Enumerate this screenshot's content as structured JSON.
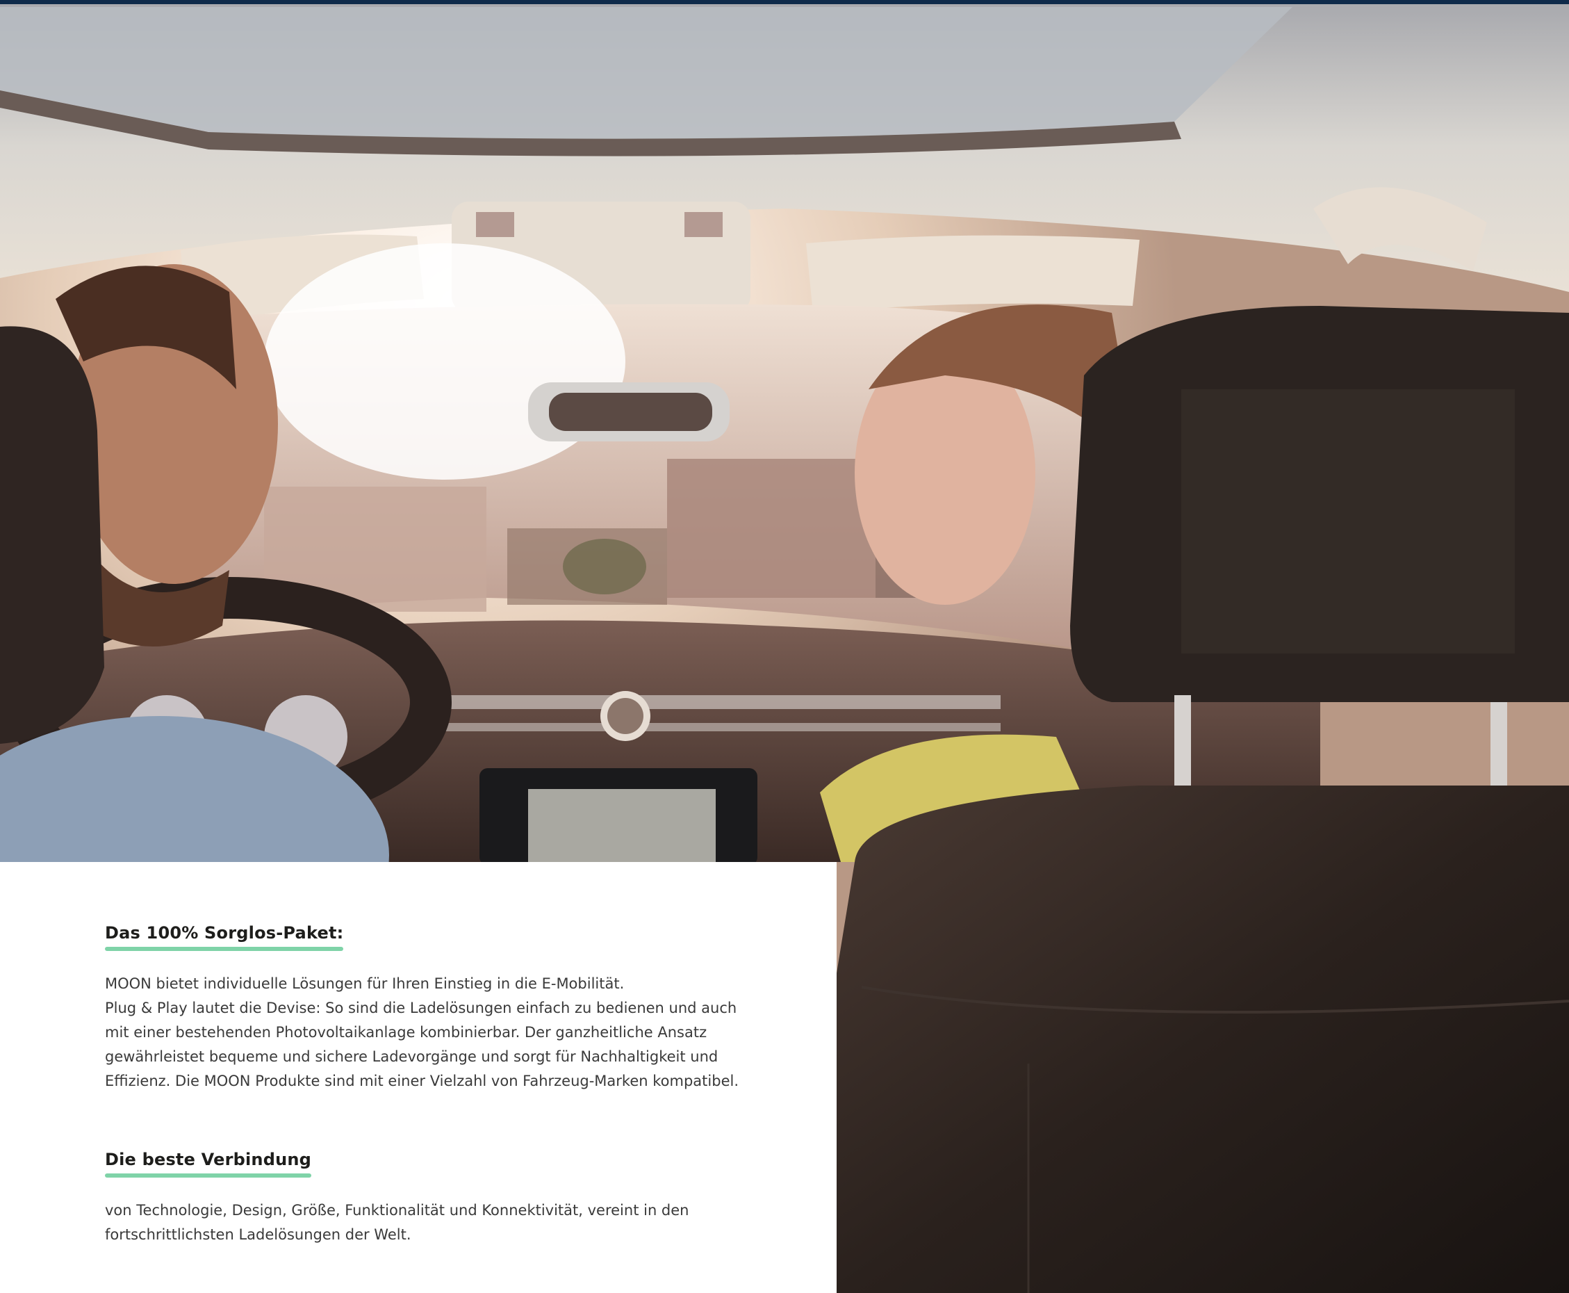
{
  "colors": {
    "top_strip": "#0e2a4a",
    "panel_background": "#ffffff",
    "accent_underline": "#7fd3a8",
    "heading_text": "#1d1d1b",
    "body_text": "#3a3a3a"
  },
  "sections": [
    {
      "heading": "Das 100% Sorglos-Paket:",
      "lines": [
        "MOON bietet individuelle Lösungen für Ihren Einstieg in die E-Mobilität.",
        "Plug & Play lautet die Devise: So sind die Ladelösungen einfach zu bedienen und auch",
        "mit einer bestehenden Photovoltaikanlage kombinierbar. Der ganzheitliche Ansatz",
        "gewährleistet bequeme und sichere Ladevorgänge und sorgt für Nachhaltigkeit und",
        "Effizienz. Die MOON Produkte sind mit einer Vielzahl von Fahrzeug-Marken kompatibel."
      ]
    },
    {
      "heading": "Die beste Verbindung",
      "lines": [
        "von Technologie, Design, Größe, Funktionalität und Konnektivität, vereint in den",
        "fortschrittlichsten Ladelösungen der Welt."
      ]
    }
  ]
}
